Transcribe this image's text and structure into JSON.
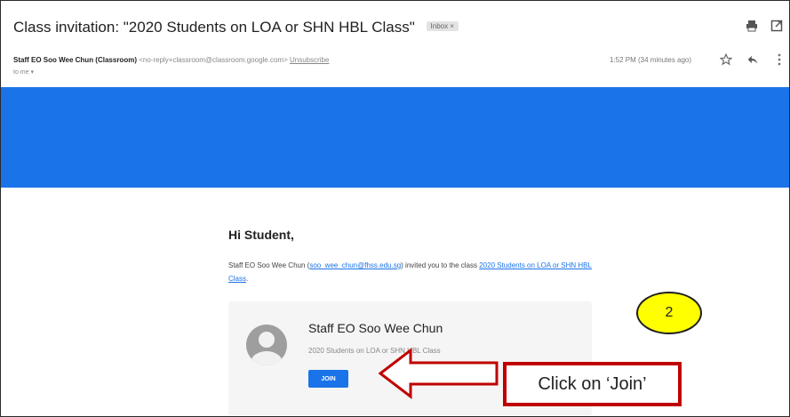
{
  "email": {
    "subject": "Class invitation: \"2020 Students on LOA or SHN HBL Class\"",
    "inbox_badge": "Inbox ×",
    "sender_name": "Staff EO Soo Wee Chun (Classroom)",
    "sender_email": "<no-reply+classroom@classroom.google.com>",
    "unsubscribe": "Unsubscribe",
    "to_line": "to me ▾",
    "time": "1:52 PM (34 minutes ago)",
    "icons": {
      "print": "print-icon",
      "popout": "open-in-new-icon",
      "star": "star-icon",
      "reply": "reply-icon",
      "more": "more-vert-icon"
    }
  },
  "banner": {
    "color": "#1a73e8"
  },
  "message": {
    "greeting": "Hi Student,",
    "text_before": "Staff EO Soo Wee Chun (",
    "teacher_email": "soo_wee_chun@fhss.edu.sg",
    "text_middle": ") invited you to the class ",
    "class_link": "2020 Students on LOA or SHN HBL Class",
    "text_after": "."
  },
  "card": {
    "teacher_name": "Staff EO Soo Wee Chun",
    "class_name": "2020 Students on LOA or SHN HBL Class",
    "join_label": "JOIN"
  },
  "annotation": {
    "step_number": "2",
    "callout_text": "Click on ‘Join’",
    "highlight_color": "#ffff00",
    "callout_color": "#c00000"
  }
}
